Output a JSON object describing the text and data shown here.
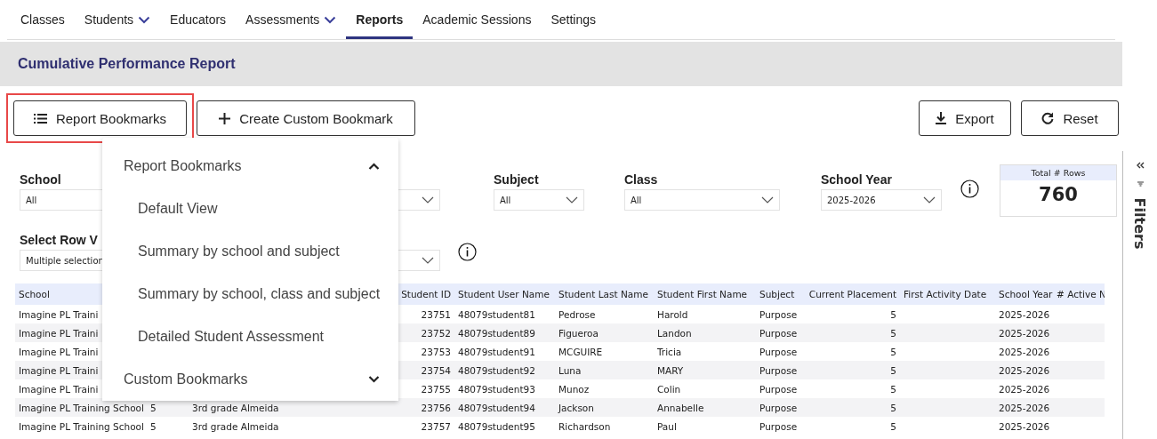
{
  "nav": {
    "tabs": [
      {
        "label": "Classes",
        "selected": false,
        "dropdown": false
      },
      {
        "label": "Students",
        "selected": false,
        "dropdown": true
      },
      {
        "label": "Educators",
        "selected": false,
        "dropdown": false
      },
      {
        "label": "Assessments",
        "selected": false,
        "dropdown": true
      },
      {
        "label": "Reports",
        "selected": true,
        "dropdown": false
      },
      {
        "label": "Academic Sessions",
        "selected": false,
        "dropdown": false
      },
      {
        "label": "Settings",
        "selected": false,
        "dropdown": false
      }
    ]
  },
  "page_title": "Cumulative Performance Report",
  "toolbar": {
    "buttons": [
      {
        "kind": "bookmarks",
        "label": "Report Bookmarks",
        "highlighted": true
      },
      {
        "kind": "add",
        "label": "Create Custom Bookmark",
        "highlighted": false
      },
      {
        "kind": "export",
        "label": "Export",
        "highlighted": false
      },
      {
        "kind": "reset",
        "label": "Reset",
        "highlighted": false
      }
    ]
  },
  "filters": [
    [
      {
        "label": "School",
        "value": "All",
        "info": false
      },
      {
        "info": false
      },
      {
        "label": "Subject",
        "value": "All",
        "info": false
      },
      {
        "label": "Class",
        "value": "All",
        "info": false
      },
      {
        "label": "School Year",
        "value": "2025-2026",
        "info": true
      }
    ],
    [
      {
        "label": "Select Row V",
        "value": "Multiple selection",
        "info": false
      },
      {
        "info": true
      }
    ]
  ],
  "total_rows": {
    "label": "Total # Rows",
    "value": "760"
  },
  "filters_panel": {
    "label": "Filters"
  },
  "bookmark_menu": {
    "sections": [
      {
        "label": "Report Bookmarks",
        "expanded": true,
        "items": [
          "Default View",
          "Summary by school and subject",
          "Summary by school, class and subject",
          "Detailed Student Assessment"
        ]
      },
      {
        "label": "Custom Bookmarks",
        "expanded": false
      }
    ]
  },
  "table": {
    "columns": [
      {
        "label": "School"
      },
      {},
      {},
      {
        "label": "Student ID"
      },
      {
        "label": "Student User Name"
      },
      {
        "label": "Student Last Name"
      },
      {
        "label": "Student First Name"
      },
      {
        "label": "Subject"
      },
      {
        "label": "Current Placement"
      },
      {
        "label": "First Activity Date"
      },
      {
        "label": "School Year"
      },
      {
        "label": "# Active N"
      }
    ],
    "rows": [
      [
        "Imagine PL Traini",
        null,
        null,
        "23751",
        "48079student81",
        "Pedrose",
        "Harold",
        "Purpose",
        "5",
        null,
        "2025-2026",
        null
      ],
      [
        "Imagine PL Traini",
        null,
        null,
        "23752",
        "48079student89",
        "Figueroa",
        "Landon",
        "Purpose",
        "5",
        null,
        "2025-2026",
        null
      ],
      [
        "Imagine PL Traini",
        null,
        null,
        "23753",
        "48079student91",
        "MCGUIRE",
        "Tricia",
        "Purpose",
        "5",
        null,
        "2025-2026",
        null
      ],
      [
        "Imagine PL Traini",
        null,
        null,
        "23754",
        "48079student92",
        "Luna",
        "MARY",
        "Purpose",
        "5",
        null,
        "2025-2026",
        null
      ],
      [
        "Imagine PL Traini",
        null,
        null,
        "23755",
        "48079student93",
        "Munoz",
        "Colin",
        "Purpose",
        "5",
        null,
        "2025-2026",
        null
      ],
      [
        "Imagine PL Training School",
        "5",
        "3rd grade Almeida",
        "23756",
        "48079student94",
        "Jackson",
        "Annabelle",
        "Purpose",
        "5",
        null,
        "2025-2026",
        null
      ],
      [
        "Imagine PL Training School",
        "5",
        "3rd grade Almeida",
        "23757",
        "48079student95",
        "Richardson",
        "Paul",
        "Purpose",
        "5",
        null,
        "2025-2026",
        null
      ]
    ]
  }
}
